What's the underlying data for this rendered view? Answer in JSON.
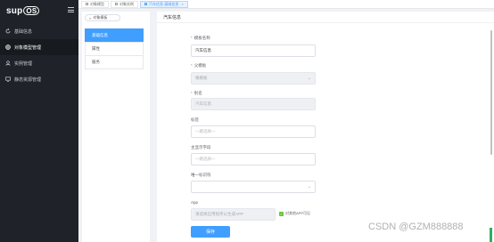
{
  "app": {
    "logo_text": "sup",
    "logo_os": "OS"
  },
  "sidebar": {
    "items": [
      {
        "label": "基础信息",
        "icon": "refresh-icon"
      },
      {
        "label": "对象模型管理",
        "icon": "globe-icon"
      },
      {
        "label": "实例管理",
        "icon": "user-icon"
      },
      {
        "label": "静态资源管理",
        "icon": "monitor-icon"
      }
    ],
    "active_index": 1
  },
  "tabs": [
    {
      "label": "对象模型"
    },
    {
      "label": "对象实例"
    },
    {
      "label": "汽车信息-基础信息",
      "active": true,
      "close": "×"
    }
  ],
  "leftnav": {
    "back_label": "对象模板",
    "back_arrow": "<",
    "items": [
      "基础信息",
      "属性",
      "服务"
    ],
    "active_index": 0
  },
  "main": {
    "title": "汽车信息",
    "fields": {
      "template_name": {
        "label": "模板名称",
        "required": true,
        "value": "汽车信息"
      },
      "parent_template": {
        "label": "父模板",
        "required": true,
        "value": "根模板"
      },
      "alias": {
        "label": "别名",
        "required": true,
        "value": "汽车信息"
      },
      "tags": {
        "label": "标签",
        "placeholder": "一路选择一"
      },
      "main_display_field": {
        "label": "主显示字段",
        "placeholder": "一路选择一"
      },
      "unique_identifier": {
        "label": "唯一标识符",
        "placeholder": ""
      },
      "app": {
        "label": "App",
        "placeholder": "请选择应用程序以生成APP",
        "checkbox_label": "对其他APP可见"
      }
    },
    "save_label": "保存"
  },
  "watermark": "CSDN @GZM888888",
  "colors": {
    "accent": "#409eff",
    "sidebar_bg": "#1f2329",
    "required": "#f56c6c",
    "checkbox": "#67c23a"
  }
}
